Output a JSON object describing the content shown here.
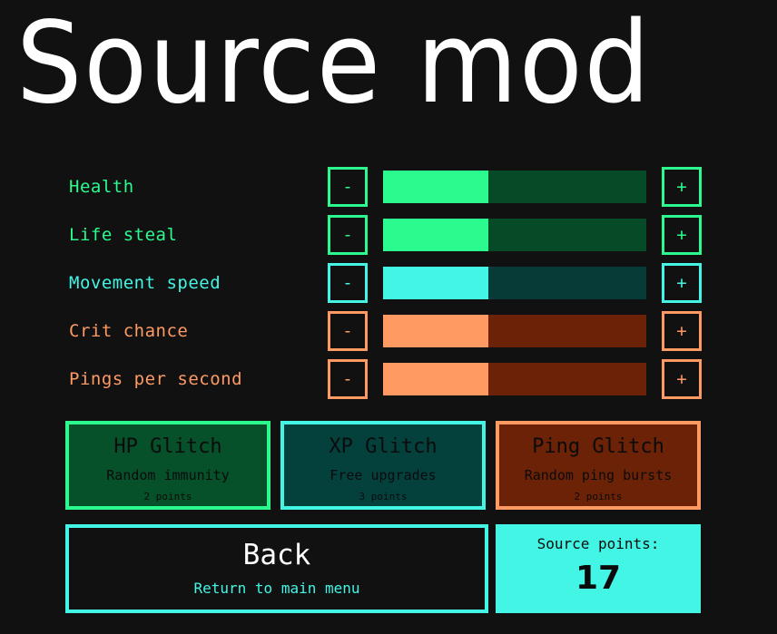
{
  "screen": {
    "title": "Source mod",
    "background_color": "#111111"
  },
  "palette": {
    "green_bright": "#2BFB8E",
    "green_dim": "#064B28",
    "cyan_bright": "#42F5E5",
    "cyan_dim": "#063B38",
    "orange_bright": "#FF9A63",
    "orange_dim": "#6B2206",
    "white": "#ffffff",
    "dark_text": "#0b0b0b"
  },
  "stats": [
    {
      "label": "Health",
      "color": "#2BFB8E",
      "dim_color": "#064B28",
      "decrement_label": "-",
      "increment_label": "+",
      "pips_total": 5,
      "pips_filled": 2
    },
    {
      "label": "Life steal",
      "color": "#2BFB8E",
      "dim_color": "#064B28",
      "decrement_label": "-",
      "increment_label": "+",
      "pips_total": 5,
      "pips_filled": 2
    },
    {
      "label": "Movement speed",
      "color": "#42F5E5",
      "dim_color": "#063B38",
      "decrement_label": "-",
      "increment_label": "+",
      "pips_total": 5,
      "pips_filled": 2
    },
    {
      "label": "Crit chance",
      "color": "#FF9A63",
      "dim_color": "#6B2206",
      "decrement_label": "-",
      "increment_label": "+",
      "pips_total": 5,
      "pips_filled": 2
    },
    {
      "label": "Pings per second",
      "color": "#FF9A63",
      "dim_color": "#6B2206",
      "decrement_label": "-",
      "increment_label": "+",
      "pips_total": 5,
      "pips_filled": 2
    }
  ],
  "glitch_cards": [
    {
      "title": "HP Glitch",
      "description": "Random immunity",
      "cost": "2 points",
      "border_color": "#2BFB8E",
      "fill_color": "#06502A"
    },
    {
      "title": "XP Glitch",
      "description": "Free upgrades",
      "cost": "3 points",
      "border_color": "#42F5E5",
      "fill_color": "#04413D"
    },
    {
      "title": "Ping Glitch",
      "description": "Random ping bursts",
      "cost": "2 points",
      "border_color": "#FF9A63",
      "fill_color": "#6B2206"
    }
  ],
  "back_button": {
    "label": "Back",
    "subtitle": "Return to main menu",
    "border_color": "#42F5E5"
  },
  "source_points": {
    "label": "Source points:",
    "value": "17",
    "background_color": "#42F5E5"
  }
}
